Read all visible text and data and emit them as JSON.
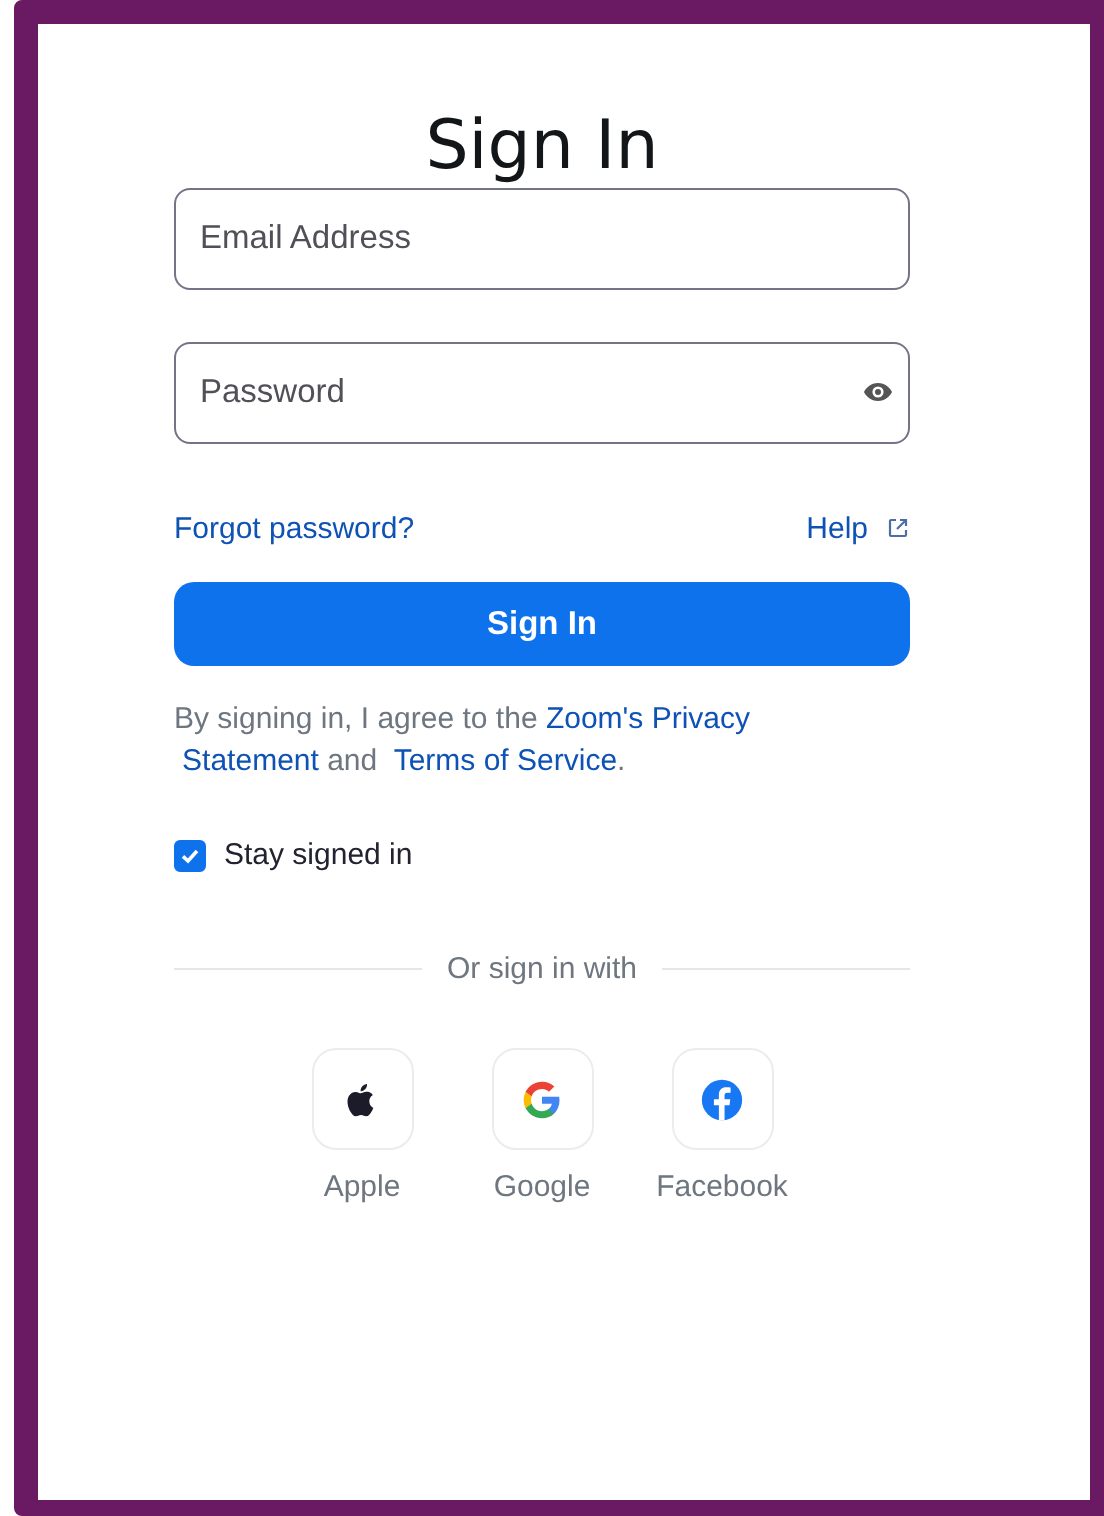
{
  "title": "Sign In",
  "fields": [
    {
      "kind": "email",
      "placeholder": "Email Address"
    },
    {
      "kind": "password",
      "placeholder": "Password"
    }
  ],
  "links": [
    {
      "kind": "forgot",
      "label": "Forgot password?"
    },
    {
      "kind": "help",
      "label": "Help"
    }
  ],
  "submit": "Sign In",
  "legal": [
    {
      "kind": "text",
      "text": "By signing in, I agree to the "
    },
    {
      "kind": "link",
      "text": "Zoom's Privacy"
    },
    {
      "kind": "link",
      "text": "Statement"
    },
    {
      "kind": "text",
      "text": " and "
    },
    {
      "kind": "link",
      "text": "Terms of Service"
    },
    {
      "kind": "text",
      "text": "."
    }
  ],
  "stay_signed_in": {
    "label": "Stay signed in",
    "checked": true
  },
  "divider": "Or sign in with",
  "providers": [
    {
      "kind": "apple",
      "label": "Apple"
    },
    {
      "kind": "google",
      "label": "Google"
    },
    {
      "kind": "facebook",
      "label": "Facebook"
    }
  ]
}
